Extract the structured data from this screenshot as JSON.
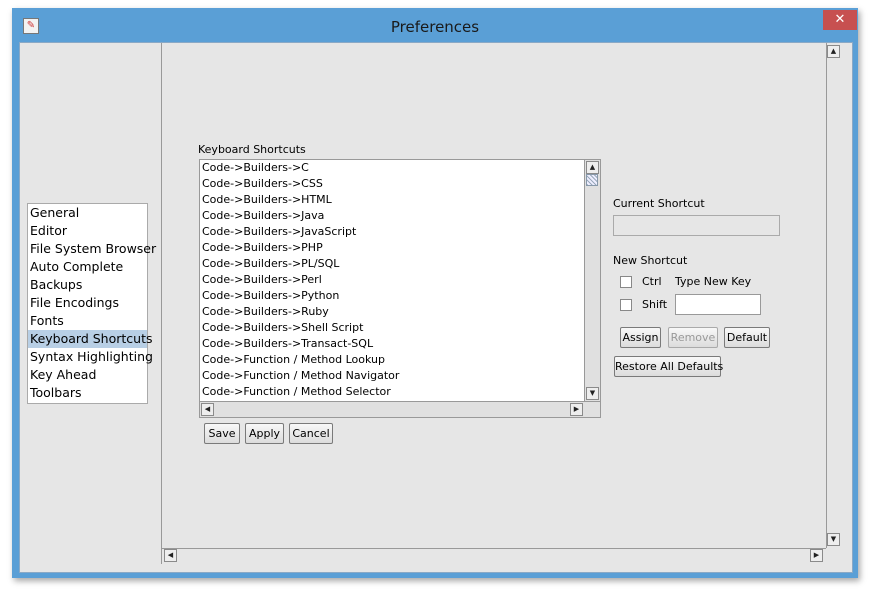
{
  "window": {
    "title": "Preferences",
    "close_symbol": "✕"
  },
  "categories": [
    {
      "label": "General"
    },
    {
      "label": "Editor"
    },
    {
      "label": "File System Browser"
    },
    {
      "label": "Auto Complete"
    },
    {
      "label": "Backups"
    },
    {
      "label": "File Encodings"
    },
    {
      "label": "Fonts"
    },
    {
      "label": "Keyboard Shortcuts",
      "selected": true
    },
    {
      "label": "Syntax Highlighting"
    },
    {
      "label": "Key Ahead"
    },
    {
      "label": "Toolbars"
    }
  ],
  "shortcuts_panel": {
    "heading": "Keyboard Shortcuts",
    "items": [
      "Code->Builders->C",
      "Code->Builders->CSS",
      "Code->Builders->HTML",
      "Code->Builders->Java",
      "Code->Builders->JavaScript",
      "Code->Builders->PHP",
      "Code->Builders->PL/SQL",
      "Code->Builders->Perl",
      "Code->Builders->Python",
      "Code->Builders->Ruby",
      "Code->Builders->Shell Script",
      "Code->Builders->Transact-SQL",
      "Code->Function / Method Lookup",
      "Code->Function / Method Navigator",
      "Code->Function / Method Selector"
    ]
  },
  "current_shortcut": {
    "label": "Current Shortcut",
    "value": ""
  },
  "new_shortcut": {
    "label": "New Shortcut",
    "ctrl_label": "Ctrl",
    "shift_label": "Shift",
    "key_label": "Type New Key",
    "key_value": ""
  },
  "buttons": {
    "assign": "Assign",
    "remove": "Remove",
    "default": "Default",
    "restore": "Restore All Defaults",
    "save": "Save",
    "apply": "Apply",
    "cancel": "Cancel"
  }
}
